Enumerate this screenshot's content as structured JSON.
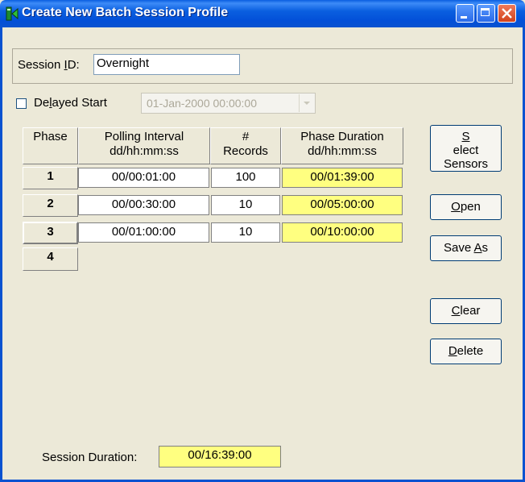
{
  "window": {
    "title": "Create New Batch Session Profile",
    "controls": {
      "minimize": "minimize",
      "maximize": "maximize",
      "close": "close"
    }
  },
  "session_id": {
    "label_pre": "Session ",
    "label_accel": "I",
    "label_post": "D:",
    "value": "Overnight"
  },
  "delayed_start": {
    "label_pre": "De",
    "label_accel": "l",
    "label_post": "ayed Start",
    "checked": false,
    "datetime": "01-Jan-2000  00:00:00"
  },
  "table": {
    "headers": {
      "phase": "Phase",
      "polling_line1": "Polling Interval",
      "polling_line2": "dd/hh:mm:ss",
      "records_line1": "#",
      "records_line2": "Records",
      "duration_line1": "Phase Duration",
      "duration_line2": "dd/hh:mm:ss"
    },
    "rows": [
      {
        "phase": "1",
        "polling": "00/00:01:00",
        "records": "100",
        "duration": "00/01:39:00"
      },
      {
        "phase": "2",
        "polling": "00/00:30:00",
        "records": "10",
        "duration": "00/05:00:00"
      },
      {
        "phase": "3",
        "polling": "00/01:00:00",
        "records": "10",
        "duration": "00/10:00:00"
      },
      {
        "phase": "4"
      }
    ]
  },
  "buttons": {
    "select_sensors": {
      "accel": "S",
      "rest1": "elect",
      "line2": "Sensors"
    },
    "open": {
      "accel": "O",
      "rest": "pen"
    },
    "save_as": {
      "pre": "Save ",
      "accel": "A",
      "post": "s"
    },
    "clear": {
      "accel": "C",
      "rest": "lear"
    },
    "delete": {
      "accel": "D",
      "rest": "elete"
    }
  },
  "session_duration": {
    "label": "Session Duration:",
    "value": "00/16:39:00"
  },
  "colors": {
    "titlebar": "#0a5fe0",
    "window_bg": "#ece9d8",
    "highlight_cell": "#ffff80"
  }
}
